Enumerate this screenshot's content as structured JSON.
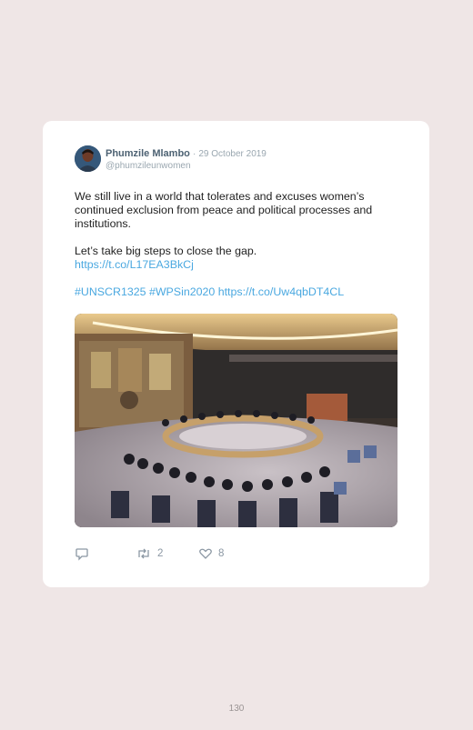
{
  "tweet": {
    "author_name": "Phumzile Mlambo",
    "separator": "·",
    "date": "29 October 2019",
    "handle": "@phumzileunwomen",
    "lines": {
      "p1": "We still live in a world that tolerates and excuses women’s continued exclusion from peace and political processes and institutions.",
      "p2": "Let’s take big steps to close the gap.",
      "link1": "https://t.co/L17EA3BkCj",
      "hashtags": "#UNSCR1325 #WPSin2020 https://t.co/Uw4qbDT4CL"
    },
    "icons": {
      "reply": "reply-icon",
      "retweet": "retweet-icon",
      "like": "heart-icon"
    },
    "retweet_count": "2",
    "like_count": "8"
  },
  "page_number": "130",
  "colors": {
    "background": "#efe6e6",
    "card": "#ffffff",
    "link": "#4aa8e0",
    "muted": "#9aa7b0"
  }
}
